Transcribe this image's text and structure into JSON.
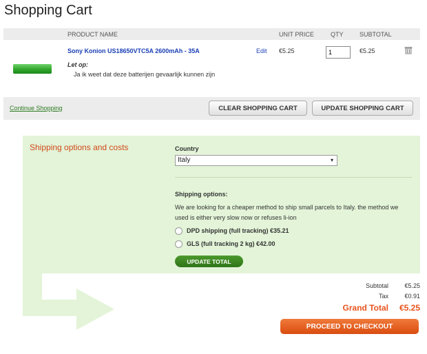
{
  "page": {
    "title": "Shopping Cart"
  },
  "cart": {
    "columns": {
      "product": "PRODUCT NAME",
      "unit_price": "UNIT PRICE",
      "qty": "QTY",
      "subtotal": "SUBTOTAL"
    },
    "items": [
      {
        "name": "Sony Konion US18650VTC5A 2600mAh - 35A",
        "note_label": "Let op:",
        "note": "Ja ik weet dat deze batterijen gevaarlijk kunnen zijn",
        "edit_label": "Edit",
        "unit_price": "€5.25",
        "qty": "1",
        "subtotal": "€5.25",
        "delete_icon": "trash-icon"
      }
    ]
  },
  "actions": {
    "continue_label": "Continue Shopping",
    "clear_label": "CLEAR SHOPPING CART",
    "update_label": "UPDATE SHOPPING CART"
  },
  "shipping": {
    "title": "Shipping options and costs",
    "country_label": "Country",
    "country_value": "Italy",
    "options_label": "Shipping options:",
    "description": "We are looking for a cheaper method to ship small parcels to Italy. the method we used is either very slow now or refuses li-ion",
    "options": [
      {
        "label": "DPD shipping (full tracking) €35.21"
      },
      {
        "label": "GLS (full tracking 2 kg) €42.00"
      }
    ],
    "update_total_label": "UPDATE TOTAL"
  },
  "totals": {
    "subtotal_label": "Subtotal",
    "subtotal_value": "€5.25",
    "tax_label": "Tax",
    "tax_value": "€0.91",
    "grand_total_label": "Grand Total",
    "grand_total_value": "€5.25",
    "checkout_label": "PROCEED TO CHECKOUT"
  },
  "colors": {
    "accent_orange": "#e8531d",
    "link_blue": "#1a3fb5",
    "panel_green": "#e3f4d8",
    "button_green": "#2f7418"
  }
}
